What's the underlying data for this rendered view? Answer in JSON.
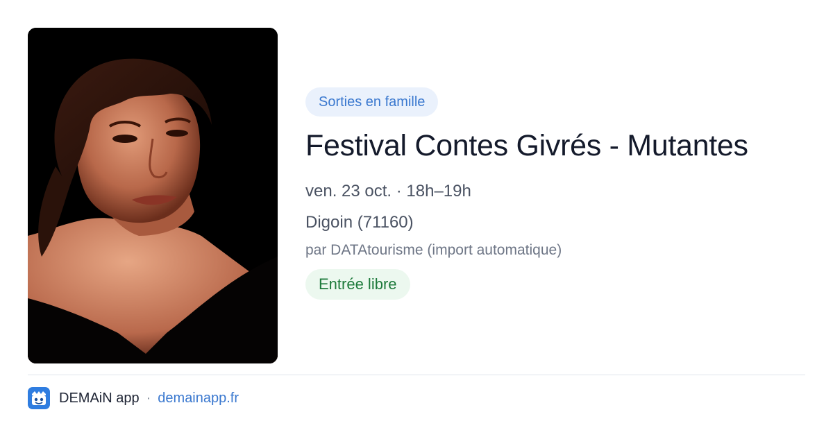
{
  "event": {
    "category": "Sorties en famille",
    "title": "Festival Contes Givrés - Mutantes",
    "datetime": "ven. 23 oct. · 18h–19h",
    "location": "Digoin (71160)",
    "source": "par DATAtourisme (import automatique)",
    "price": "Entrée libre"
  },
  "footer": {
    "app_name": "DEMAiN app",
    "separator": "·",
    "site": "demainapp.fr"
  },
  "icons": {
    "app": "demain-app-icon",
    "photo": "event-photo"
  },
  "colors": {
    "accent_blue": "#3a78cf",
    "category_bg": "#eaf1fc",
    "price_green": "#1d7a3b",
    "price_bg": "#ecf8ef",
    "title": "#141a2b"
  }
}
